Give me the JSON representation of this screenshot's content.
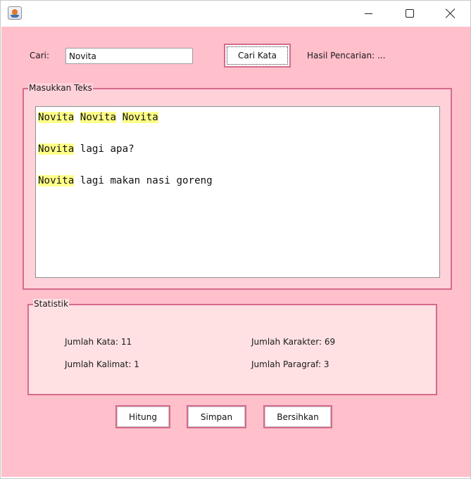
{
  "window": {
    "colors": {
      "content_bg": "#ffbfcb",
      "border_accent": "#d56b8c",
      "highlight": "#ffff88"
    }
  },
  "search": {
    "label": "Cari:",
    "value": "Novita",
    "button_label": "Cari Kata",
    "result_text": "Hasil Pencarian: ..."
  },
  "text_panel": {
    "title": "Masukkan Teks",
    "highlight_word": "Novita",
    "lines": [
      [
        "Novita",
        " ",
        "Novita",
        " ",
        "Novita"
      ],
      [],
      [
        "Novita",
        " lagi apa?"
      ],
      [],
      [
        "Novita",
        " lagi makan nasi goreng"
      ]
    ]
  },
  "stats": {
    "title": "Statistik",
    "jumlah_kata": "Jumlah Kata: 11",
    "jumlah_karakter": "Jumlah Karakter: 69",
    "jumlah_kalimat": "Jumlah Kalimat: 1",
    "jumlah_paragraf": "Jumlah Paragraf: 3"
  },
  "actions": {
    "hitung": "Hitung",
    "simpan": "Simpan",
    "bersihkan": "Bersihkan"
  },
  "icons": {
    "app": "java-app-icon",
    "minimize": "minimize-icon",
    "maximize": "maximize-icon",
    "close": "close-icon"
  }
}
